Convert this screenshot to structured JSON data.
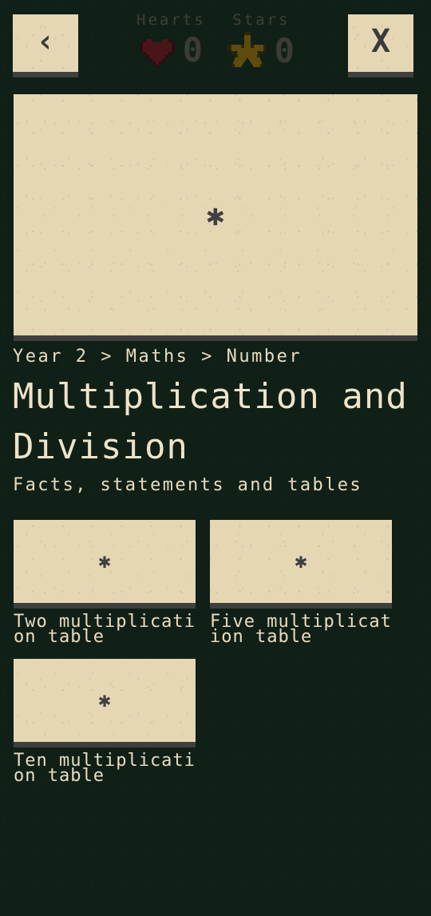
{
  "theme": {
    "background": "#102017",
    "panel": "#e6d7b4",
    "shadow": "#3f3f3f",
    "text_light": "#e9dcc0",
    "text_dim": "#3d4038",
    "heart_color": "#4a1519",
    "star_color": "#5f4c0d"
  },
  "topbar": {
    "back_label": "‹",
    "close_label": "X",
    "counters": [
      {
        "label": "Hearts",
        "icon": "heart-icon",
        "value": "0"
      },
      {
        "label": "Stars",
        "icon": "star-icon",
        "value": "0"
      }
    ]
  },
  "hero": {
    "placeholder_glyph": "✱",
    "alt": "broken-image-placeholder"
  },
  "content": {
    "breadcrumb": "Year 2 > Maths > Number",
    "title": "Multiplication and Division",
    "subtitle": "Facts, statements and tables"
  },
  "cards": [
    {
      "label": "Two multiplication table",
      "placeholder_glyph": "✱"
    },
    {
      "label": "Five multiplication table",
      "placeholder_glyph": "✱"
    },
    {
      "label": "Ten multiplication table",
      "placeholder_glyph": "✱"
    }
  ]
}
